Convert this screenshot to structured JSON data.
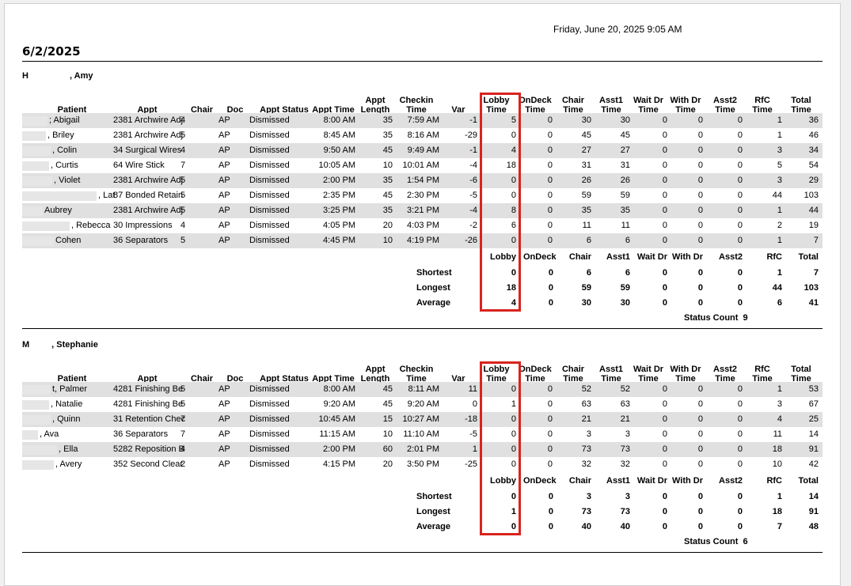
{
  "header": {
    "print_date": "Friday, June 20, 2025 9:05 AM",
    "report_date": "6/2/2025"
  },
  "columns": {
    "patient": "Patient",
    "appt": "Appt",
    "chair": "Chair",
    "doc": "Doc",
    "appt_status": "Appt Status",
    "appt_time": "Appt Time",
    "appt_length_1": "Appt",
    "appt_length_2": "Length",
    "checkin_1": "Checkin",
    "checkin_2": "Time",
    "var": "Var",
    "lobby_1": "Lobby",
    "lobby_2": "Time",
    "ondeck_1": "OnDeck",
    "ondeck_2": "Time",
    "chair_t_1": "Chair",
    "chair_t_2": "Time",
    "asst1_1": "Asst1",
    "asst1_2": "Time",
    "waitdr_1": "Wait Dr",
    "waitdr_2": "Time",
    "withdr_1": "With Dr",
    "withdr_2": "Time",
    "asst2_1": "Asst2",
    "asst2_2": "Time",
    "rfc_1": "RfC",
    "rfc_2": "Time",
    "total_1": "Total",
    "total_2": "Time"
  },
  "summary_labels": {
    "lobby": "Lobby",
    "ondeck": "OnDeck",
    "chair": "Chair",
    "asst1": "Asst1",
    "waitdr": "Wait Dr",
    "withdr": "With Dr",
    "asst2": "Asst2",
    "rfc": "RfC",
    "total": "Total",
    "shortest": "Shortest",
    "longest": "Longest",
    "average": "Average"
  },
  "sections": [
    {
      "provider_initial": "H",
      "provider_rest": ", Amy",
      "rows": [
        {
          "patient": "; Abigail",
          "appt": "2381 Archwire Adj",
          "chair": "4",
          "doc": "AP",
          "status": "Dismissed",
          "time": "8:00 AM",
          "length": "35",
          "checkin": "7:59 AM",
          "var": "-1",
          "lobby": "5",
          "ondeck": "0",
          "chair_t": "30",
          "asst1": "30",
          "waitdr": "0",
          "withdr": "0",
          "asst2": "0",
          "rfc": "1",
          "total": "36"
        },
        {
          "patient": ", Briley",
          "appt": "2381 Archwire Adj",
          "chair": "5",
          "doc": "AP",
          "status": "Dismissed",
          "time": "8:45 AM",
          "length": "35",
          "checkin": "8:16 AM",
          "var": "-29",
          "lobby": "0",
          "ondeck": "0",
          "chair_t": "45",
          "asst1": "45",
          "waitdr": "0",
          "withdr": "0",
          "asst2": "0",
          "rfc": "1",
          "total": "46"
        },
        {
          "patient": ", Colin",
          "appt": "34 Surgical Wires",
          "chair": "4",
          "doc": "AP",
          "status": "Dismissed",
          "time": "9:50 AM",
          "length": "45",
          "checkin": "9:49 AM",
          "var": "-1",
          "lobby": "4",
          "ondeck": "0",
          "chair_t": "27",
          "asst1": "27",
          "waitdr": "0",
          "withdr": "0",
          "asst2": "0",
          "rfc": "3",
          "total": "34"
        },
        {
          "patient": ", Curtis",
          "appt": "64 Wire Stick",
          "chair": "7",
          "doc": "AP",
          "status": "Dismissed",
          "time": "10:05 AM",
          "length": "10",
          "checkin": "10:01 AM",
          "var": "-4",
          "lobby": "18",
          "ondeck": "0",
          "chair_t": "31",
          "asst1": "31",
          "waitdr": "0",
          "withdr": "0",
          "asst2": "0",
          "rfc": "5",
          "total": "54"
        },
        {
          "patient": ", Violet",
          "appt": "2381 Archwire Adj",
          "chair": "5",
          "doc": "AP",
          "status": "Dismissed",
          "time": "2:00 PM",
          "length": "35",
          "checkin": "1:54 PM",
          "var": "-6",
          "lobby": "0",
          "ondeck": "0",
          "chair_t": "26",
          "asst1": "26",
          "waitdr": "0",
          "withdr": "0",
          "asst2": "0",
          "rfc": "3",
          "total": "29"
        },
        {
          "patient": ", Lat",
          "appt": "87 Bonded Retain",
          "chair": "5",
          "doc": "AP",
          "status": "Dismissed",
          "time": "2:35 PM",
          "length": "45",
          "checkin": "2:30 PM",
          "var": "-5",
          "lobby": "0",
          "ondeck": "0",
          "chair_t": "59",
          "asst1": "59",
          "waitdr": "0",
          "withdr": "0",
          "asst2": "0",
          "rfc": "44",
          "total": "103"
        },
        {
          "patient": "Aubrey",
          "appt": "2381 Archwire Adj",
          "chair": "5",
          "doc": "AP",
          "status": "Dismissed",
          "time": "3:25 PM",
          "length": "35",
          "checkin": "3:21 PM",
          "var": "-4",
          "lobby": "8",
          "ondeck": "0",
          "chair_t": "35",
          "asst1": "35",
          "waitdr": "0",
          "withdr": "0",
          "asst2": "0",
          "rfc": "1",
          "total": "44"
        },
        {
          "patient": ", Rebecca",
          "appt": "30 Impressions",
          "chair": "4",
          "doc": "AP",
          "status": "Dismissed",
          "time": "4:05 PM",
          "length": "20",
          "checkin": "4:03 PM",
          "var": "-2",
          "lobby": "6",
          "ondeck": "0",
          "chair_t": "11",
          "asst1": "11",
          "waitdr": "0",
          "withdr": "0",
          "asst2": "0",
          "rfc": "2",
          "total": "19"
        },
        {
          "patient": "Cohen",
          "appt": "36 Separators",
          "chair": "5",
          "doc": "AP",
          "status": "Dismissed",
          "time": "4:45 PM",
          "length": "10",
          "checkin": "4:19 PM",
          "var": "-26",
          "lobby": "0",
          "ondeck": "0",
          "chair_t": "6",
          "asst1": "6",
          "waitdr": "0",
          "withdr": "0",
          "asst2": "0",
          "rfc": "1",
          "total": "7"
        }
      ],
      "shortest": {
        "lobby": "0",
        "ondeck": "0",
        "chair": "6",
        "asst1": "6",
        "waitdr": "0",
        "withdr": "0",
        "asst2": "0",
        "rfc": "1",
        "total": "7"
      },
      "longest": {
        "lobby": "18",
        "ondeck": "0",
        "chair": "59",
        "asst1": "59",
        "waitdr": "0",
        "withdr": "0",
        "asst2": "0",
        "rfc": "44",
        "total": "103"
      },
      "average": {
        "lobby": "4",
        "ondeck": "0",
        "chair": "30",
        "asst1": "30",
        "waitdr": "0",
        "withdr": "0",
        "asst2": "0",
        "rfc": "6",
        "total": "41"
      },
      "status_count": "Status Count  9"
    },
    {
      "provider_initial": "M",
      "provider_rest": ", Stephanie",
      "rows": [
        {
          "patient": "t, Palmer",
          "appt": "4281 Finishing Be",
          "chair": "5",
          "doc": "AP",
          "status": "Dismissed",
          "time": "8:00 AM",
          "length": "45",
          "checkin": "8:11 AM",
          "var": "11",
          "lobby": "0",
          "ondeck": "0",
          "chair_t": "52",
          "asst1": "52",
          "waitdr": "0",
          "withdr": "0",
          "asst2": "0",
          "rfc": "1",
          "total": "53"
        },
        {
          "patient": ", Natalie",
          "appt": "4281 Finishing Be",
          "chair": "5",
          "doc": "AP",
          "status": "Dismissed",
          "time": "9:20 AM",
          "length": "45",
          "checkin": "9:20 AM",
          "var": "0",
          "lobby": "1",
          "ondeck": "0",
          "chair_t": "63",
          "asst1": "63",
          "waitdr": "0",
          "withdr": "0",
          "asst2": "0",
          "rfc": "3",
          "total": "67"
        },
        {
          "patient": ", Quinn",
          "appt": "31 Retention Chec",
          "chair": "7",
          "doc": "AP",
          "status": "Dismissed",
          "time": "10:45 AM",
          "length": "15",
          "checkin": "10:27 AM",
          "var": "-18",
          "lobby": "0",
          "ondeck": "0",
          "chair_t": "21",
          "asst1": "21",
          "waitdr": "0",
          "withdr": "0",
          "asst2": "0",
          "rfc": "4",
          "total": "25"
        },
        {
          "patient": ", Ava",
          "appt": "36 Separators",
          "chair": "7",
          "doc": "AP",
          "status": "Dismissed",
          "time": "11:15 AM",
          "length": "10",
          "checkin": "11:10 AM",
          "var": "-5",
          "lobby": "0",
          "ondeck": "0",
          "chair_t": "3",
          "asst1": "3",
          "waitdr": "0",
          "withdr": "0",
          "asst2": "0",
          "rfc": "11",
          "total": "14"
        },
        {
          "patient": ", Ella",
          "appt": "5282 Reposition B",
          "chair": "4",
          "doc": "AP",
          "status": "Dismissed",
          "time": "2:00 PM",
          "length": "60",
          "checkin": "2:01 PM",
          "var": "1",
          "lobby": "0",
          "ondeck": "0",
          "chair_t": "73",
          "asst1": "73",
          "waitdr": "0",
          "withdr": "0",
          "asst2": "0",
          "rfc": "18",
          "total": "91"
        },
        {
          "patient": ", Avery",
          "appt": "352 Second Clear",
          "chair": "2",
          "doc": "AP",
          "status": "Dismissed",
          "time": "4:15 PM",
          "length": "20",
          "checkin": "3:50 PM",
          "var": "-25",
          "lobby": "0",
          "ondeck": "0",
          "chair_t": "32",
          "asst1": "32",
          "waitdr": "0",
          "withdr": "0",
          "asst2": "0",
          "rfc": "10",
          "total": "42"
        }
      ],
      "shortest": {
        "lobby": "0",
        "ondeck": "0",
        "chair": "3",
        "asst1": "3",
        "waitdr": "0",
        "withdr": "0",
        "asst2": "0",
        "rfc": "1",
        "total": "14"
      },
      "longest": {
        "lobby": "1",
        "ondeck": "0",
        "chair": "73",
        "asst1": "73",
        "waitdr": "0",
        "withdr": "0",
        "asst2": "0",
        "rfc": "18",
        "total": "91"
      },
      "average": {
        "lobby": "0",
        "ondeck": "0",
        "chair": "40",
        "asst1": "40",
        "waitdr": "0",
        "withdr": "0",
        "asst2": "0",
        "rfc": "7",
        "total": "48"
      },
      "status_count": "Status Count  6"
    }
  ],
  "highlight_color": "#d9231e"
}
